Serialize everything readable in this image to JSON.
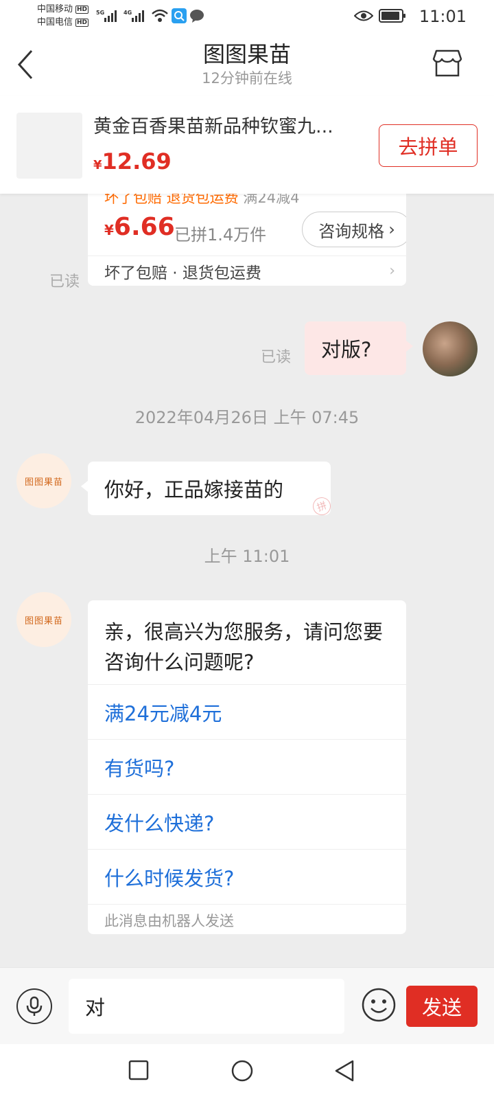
{
  "status_bar": {
    "carrier1": "中国移动",
    "carrier2": "中国电信",
    "hd": "HD",
    "net1": "5G",
    "net2": "4G",
    "time": "11:01"
  },
  "header": {
    "title": "图图果苗",
    "subtitle": "12分钟前在线"
  },
  "product": {
    "title": "黄金百香果苗新品种钦蜜九...",
    "currency": "¥",
    "price": "12.69",
    "group_button": "去拼单"
  },
  "product_card": {
    "promo_text": "坏了包赔 退货包运费",
    "promo_sub": "满24减4",
    "currency": "¥",
    "price": "6.66",
    "sold": "已拼1.4万件",
    "spec_button": "咨询规格",
    "guarantee": "坏了包赔 · 退货包运费"
  },
  "messages": {
    "read_label": "已读",
    "user_message": "对版?",
    "time1": "2022年04月26日 上午 07:45",
    "shop_reply1": "你好，正品嫁接苗的",
    "stamp": "拼",
    "time2": "上午 11:01",
    "shop_reply2": "亲，很高兴为您服务，请问您要咨询什么问题呢?",
    "quick_questions": [
      "满24元减4元",
      "有货吗?",
      "发什么快递?",
      "什么时候发货?"
    ],
    "robot_note": "此消息由机器人发送"
  },
  "shop_avatar_text": "图图果苗",
  "input_bar": {
    "input_value": "对",
    "send_label": "发送"
  },
  "colors": {
    "accent": "#e02e24",
    "link": "#1e6fd9",
    "bubble_me": "#fde7e6",
    "background": "#ededed"
  }
}
